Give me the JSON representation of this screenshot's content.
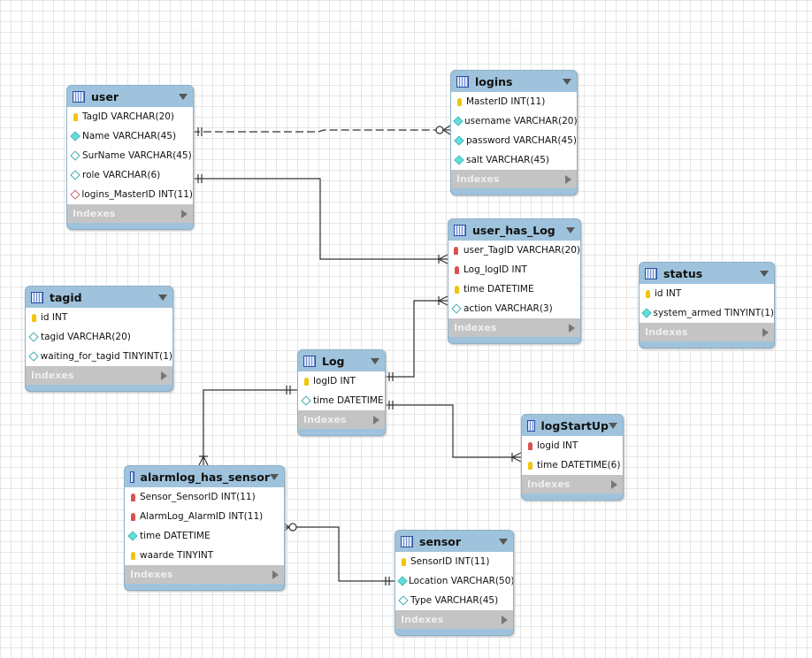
{
  "tables": [
    {
      "id": "user",
      "name": "user",
      "columns": [
        {
          "icon": "pk",
          "text": "TagID VARCHAR(20)"
        },
        {
          "icon": "nn",
          "text": "Name VARCHAR(45)"
        },
        {
          "icon": "nul",
          "text": "SurName VARCHAR(45)"
        },
        {
          "icon": "nul",
          "text": "role VARCHAR(6)"
        },
        {
          "icon": "fkn",
          "text": "logins_MasterID INT(11)"
        }
      ],
      "indexes": "Indexes"
    },
    {
      "id": "logins",
      "name": "logins",
      "columns": [
        {
          "icon": "pk",
          "text": "MasterID INT(11)"
        },
        {
          "icon": "nn",
          "text": "username VARCHAR(20)"
        },
        {
          "icon": "nn",
          "text": "password VARCHAR(45)"
        },
        {
          "icon": "nn",
          "text": "salt VARCHAR(45)"
        }
      ],
      "indexes": "Indexes"
    },
    {
      "id": "user_has_Log",
      "name": "user_has_Log",
      "columns": [
        {
          "icon": "fk",
          "text": "user_TagID VARCHAR(20)"
        },
        {
          "icon": "fk",
          "text": "Log_logID INT"
        },
        {
          "icon": "pk",
          "text": "time DATETIME"
        },
        {
          "icon": "nul",
          "text": "action VARCHAR(3)"
        }
      ],
      "indexes": "Indexes"
    },
    {
      "id": "status",
      "name": "status",
      "columns": [
        {
          "icon": "pk",
          "text": "id INT"
        },
        {
          "icon": "nn",
          "text": "system_armed TINYINT(1)"
        }
      ],
      "indexes": "Indexes"
    },
    {
      "id": "tagid",
      "name": "tagid",
      "columns": [
        {
          "icon": "pk",
          "text": "id INT"
        },
        {
          "icon": "nul",
          "text": "tagid VARCHAR(20)"
        },
        {
          "icon": "nul",
          "text": "waiting_for_tagid TINYINT(1)"
        }
      ],
      "indexes": "Indexes"
    },
    {
      "id": "Log",
      "name": "Log",
      "columns": [
        {
          "icon": "pk",
          "text": "logID INT"
        },
        {
          "icon": "nul",
          "text": "time DATETIME"
        }
      ],
      "indexes": "Indexes"
    },
    {
      "id": "logStartUp",
      "name": "logStartUp",
      "columns": [
        {
          "icon": "fk",
          "text": "logid INT"
        },
        {
          "icon": "pk",
          "text": "time DATETIME(6)"
        }
      ],
      "indexes": "Indexes"
    },
    {
      "id": "alarmlog_has_sensor",
      "name": "alarmlog_has_sensor",
      "columns": [
        {
          "icon": "fk",
          "text": "Sensor_SensorID INT(11)"
        },
        {
          "icon": "fk",
          "text": "AlarmLog_AlarmID INT(11)"
        },
        {
          "icon": "nn",
          "text": "time DATETIME"
        },
        {
          "icon": "pk",
          "text": "waarde TINYINT"
        }
      ],
      "indexes": "Indexes"
    },
    {
      "id": "sensor",
      "name": "sensor",
      "columns": [
        {
          "icon": "pk",
          "text": "SensorID INT(11)"
        },
        {
          "icon": "nn",
          "text": "Location VARCHAR(50)"
        },
        {
          "icon": "nul",
          "text": "Type VARCHAR(45)"
        }
      ],
      "indexes": "Indexes"
    }
  ],
  "relationships": [
    {
      "from": "user",
      "to": "logins",
      "type": "one-to-zero-or-many",
      "identifying": false
    },
    {
      "from": "user",
      "to": "user_has_Log",
      "type": "one-to-many",
      "identifying": true
    },
    {
      "from": "Log",
      "to": "user_has_Log",
      "type": "one-to-many",
      "identifying": true
    },
    {
      "from": "Log",
      "to": "logStartUp",
      "type": "one-to-many",
      "identifying": true
    },
    {
      "from": "Log",
      "to": "alarmlog_has_sensor",
      "type": "one-to-many",
      "identifying": true
    },
    {
      "from": "sensor",
      "to": "alarmlog_has_sensor",
      "type": "one-to-zero-or-many",
      "identifying": true
    }
  ]
}
